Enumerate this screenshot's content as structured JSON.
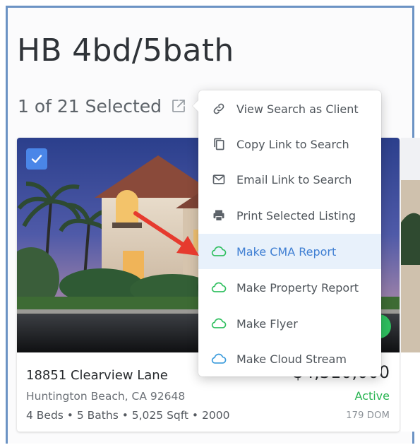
{
  "header": {
    "title": "HB 4bd/5bath",
    "selected_text": "1 of 21 Selected"
  },
  "listing": {
    "address": "18851 Clearview Lane",
    "city": "Huntington Beach, CA 92648",
    "specs": "4 Beds • 5 Baths • 5,025 Sqft • 2000",
    "price_visible": "$4,310,000",
    "status": "Active",
    "dom": "179 DOM",
    "selected": true
  },
  "menu": {
    "items": [
      {
        "label": "View Search as Client",
        "icon": "link-icon"
      },
      {
        "label": "Copy Link to Search",
        "icon": "copy-icon"
      },
      {
        "label": "Email Link to Search",
        "icon": "mail-icon"
      },
      {
        "label": "Print Selected Listing",
        "icon": "printer-icon"
      },
      {
        "label": "Make CMA Report",
        "icon": "cloud-icon-green",
        "highlighted": true
      },
      {
        "label": "Make Property Report",
        "icon": "cloud-icon-green"
      },
      {
        "label": "Make Flyer",
        "icon": "cloud-icon-green"
      },
      {
        "label": "Make Cloud Stream",
        "icon": "cloud-icon-blue"
      }
    ]
  },
  "colors": {
    "accent_blue": "#4a86e8",
    "active_green": "#28b451",
    "highlight_bg": "#e8f1fb",
    "arrow_red": "#e63a2e",
    "frame_blue": "#6c93c4"
  }
}
